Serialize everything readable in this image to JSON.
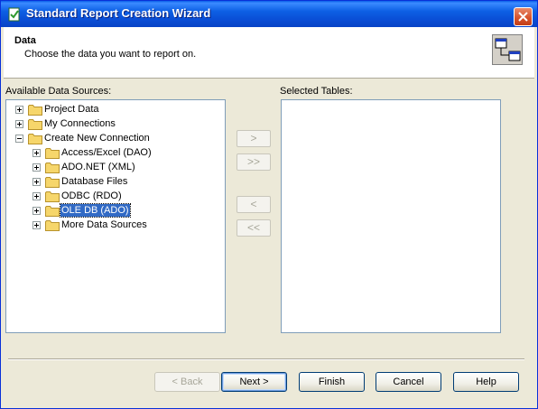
{
  "window": {
    "title": "Standard Report Creation Wizard"
  },
  "header": {
    "title": "Data",
    "subtitle": "Choose the data you want to report on."
  },
  "available": {
    "label": "Available Data Sources:",
    "items": [
      {
        "label": "Project Data",
        "expander": "plus"
      },
      {
        "label": "My Connections",
        "expander": "plus"
      },
      {
        "label": "Create New Connection",
        "expander": "minus"
      },
      {
        "label": "Access/Excel (DAO)",
        "expander": "plus"
      },
      {
        "label": "ADO.NET (XML)",
        "expander": "plus"
      },
      {
        "label": "Database Files",
        "expander": "plus"
      },
      {
        "label": "ODBC (RDO)",
        "expander": "plus"
      },
      {
        "label": "OLE DB (ADO)",
        "expander": "plus",
        "selected": true
      },
      {
        "label": "More Data Sources",
        "expander": "plus"
      }
    ]
  },
  "selected": {
    "label": "Selected Tables:"
  },
  "transfer": {
    "add": ">",
    "add_all": ">>",
    "remove": "<",
    "remove_all": "<<"
  },
  "buttons": {
    "back": "< Back",
    "next": "Next >",
    "finish": "Finish",
    "cancel": "Cancel",
    "help": "Help"
  }
}
